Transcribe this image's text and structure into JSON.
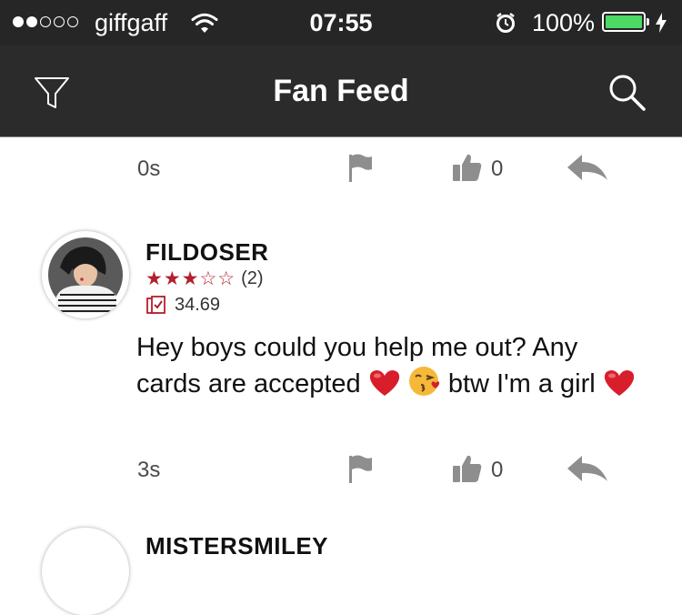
{
  "status_bar": {
    "carrier": "giffgaff",
    "time": "07:55",
    "battery_percent": "100%",
    "signal_bars_filled": 2,
    "signal_bars_total": 5
  },
  "nav": {
    "title": "Fan Feed",
    "filter_icon": "filter-icon",
    "search_icon": "search-icon"
  },
  "prev_post": {
    "time": "0s",
    "like_count": "0"
  },
  "post": {
    "author": "FILDOSER",
    "stars": "★★★☆☆",
    "rating_value": 3,
    "rating_count": "(2)",
    "balance": "34.69",
    "text_part1": "Hey boys could you help me out?  Any cards are accepted",
    "text_part2": "btw I'm a girl",
    "emojis": [
      "red-heart",
      "kissing-face",
      "red-heart"
    ],
    "time": "3s",
    "like_count": "0"
  },
  "next_post": {
    "author_partial": "MISTERSMILEY"
  },
  "colors": {
    "bar_bg": "#262626",
    "nav_bg": "#2b2b2b",
    "star_red": "#b21f2d",
    "icon_gray": "#8e8e8e",
    "battery_green": "#4cd964"
  }
}
